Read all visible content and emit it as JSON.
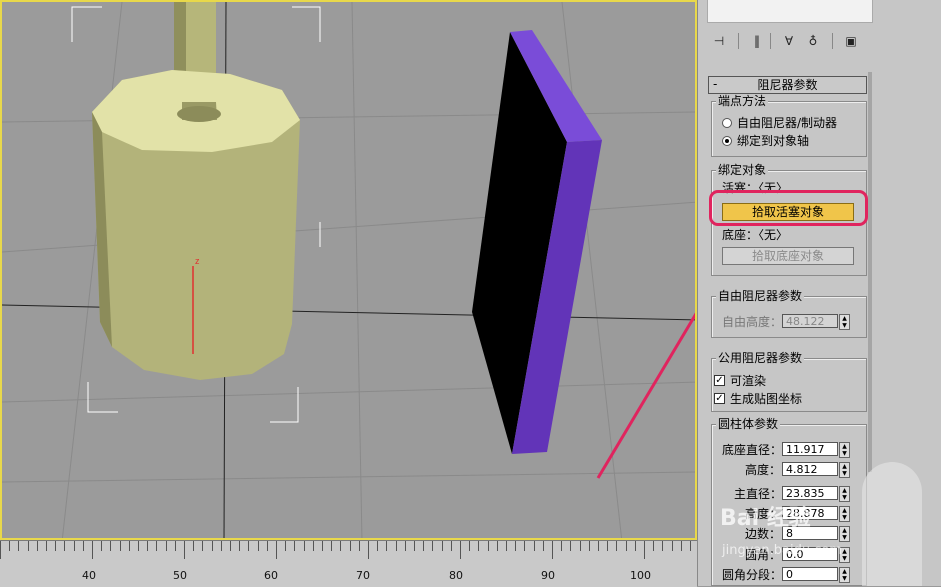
{
  "viewport": {
    "name": "perspective-viewport",
    "colors": {
      "border": "#e8d84a",
      "background": "#9b9b9b",
      "cylinder": "#bfbf7a",
      "board_face": "#000000",
      "board_edge": "#6a3cc0",
      "arrow": "#e0245e",
      "gizmo": "#ffffff",
      "axis": "#e03030"
    },
    "axis_label": "z"
  },
  "timeline_ruler": {
    "ticks": [
      "40",
      "50",
      "60",
      "70",
      "80",
      "90",
      "100"
    ]
  },
  "panel": {
    "toolbar_icons": [
      "pin-stack-icon",
      "modifier-stack-icon",
      "make-unique-icon",
      "remove-modifier-icon",
      "configure-sets-icon"
    ],
    "damper_rollout": {
      "title": "阻尼器参数",
      "collapse_glyph": "-",
      "endpoint_group": {
        "title": "端点方法",
        "options": [
          "自由阻尼器/制动器",
          "绑定到对象轴"
        ],
        "selected_index": 1
      },
      "bind_group": {
        "title": "绑定对象",
        "piston_label": "活塞：〈无〉",
        "pick_piston_button": "拾取活塞对象",
        "base_label": "底座：〈无〉",
        "pick_base_button": "拾取底座对象"
      },
      "free_damper_group": {
        "title": "自由阻尼器参数",
        "free_height_label": "自由高度：",
        "free_height_value": "48.122"
      },
      "common_group": {
        "title": "公用阻尼器参数",
        "renderable_label": "可渲染",
        "renderable_checked": true,
        "mapping_label": "生成贴图坐标",
        "mapping_checked": true
      },
      "cylinder_group": {
        "title": "圆柱体参数",
        "fields": [
          {
            "label": "底座直径：",
            "value": "11.917"
          },
          {
            "label": "高度：",
            "value": "4.812"
          },
          {
            "label": "主直径：",
            "value": "23.835"
          },
          {
            "label": "高度：",
            "value": "28.878"
          },
          {
            "label": "边数：",
            "value": "8"
          },
          {
            "label": "圆角：",
            "value": "0.0"
          },
          {
            "label": "圆角分段：",
            "value": "0"
          }
        ]
      }
    }
  },
  "watermark": {
    "text": "Bai 经验",
    "url_text": "jingyan.baidu.com"
  }
}
